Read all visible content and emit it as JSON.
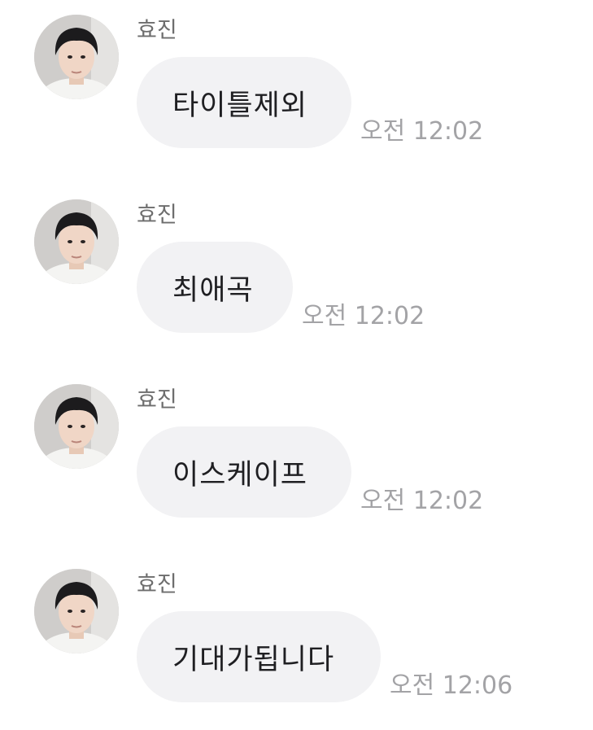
{
  "messages": [
    {
      "sender": "효진",
      "text": "타이틀제외",
      "time": "오전 12:02"
    },
    {
      "sender": "효진",
      "text": "최애곡",
      "time": "오전 12:02"
    },
    {
      "sender": "효진",
      "text": "이스케이프",
      "time": "오전 12:02"
    },
    {
      "sender": "효진",
      "text": "기대가됩니다",
      "time": "오전 12:06"
    }
  ]
}
